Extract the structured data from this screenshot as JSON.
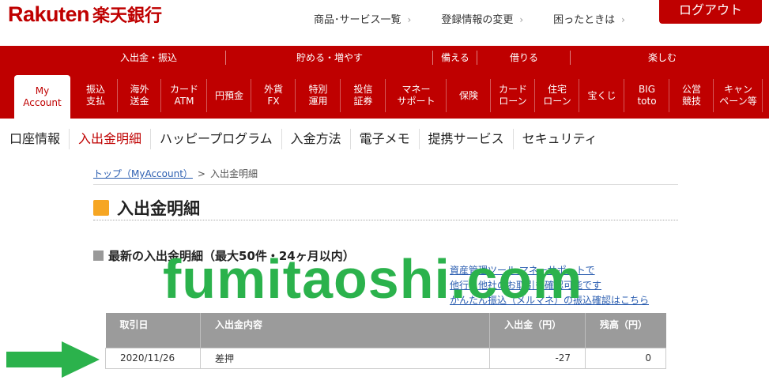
{
  "header": {
    "logo_en": "Rakuten",
    "logo_ja": "楽天銀行",
    "top_links": [
      "商品･サービス一覧",
      "登録情報の変更",
      "困ったときは"
    ],
    "logout_label": "ログアウト"
  },
  "categories": [
    "入出金・振込",
    "貯める・増やす",
    "備える",
    "借りる",
    "楽しむ"
  ],
  "nav": [
    {
      "line1": "My",
      "line2": "Account"
    },
    {
      "line1": "振込",
      "line2": "支払"
    },
    {
      "line1": "海外",
      "line2": "送金"
    },
    {
      "line1": "カード",
      "line2": "ATM"
    },
    {
      "line1": "円預金",
      "line2": ""
    },
    {
      "line1": "外貨",
      "line2": "FX"
    },
    {
      "line1": "特別",
      "line2": "運用"
    },
    {
      "line1": "投信",
      "line2": "証券"
    },
    {
      "line1": "マネー",
      "line2": "サポート"
    },
    {
      "line1": "保険",
      "line2": ""
    },
    {
      "line1": "カード",
      "line2": "ローン"
    },
    {
      "line1": "住宅",
      "line2": "ローン"
    },
    {
      "line1": "宝くじ",
      "line2": ""
    },
    {
      "line1": "BIG",
      "line2": "toto"
    },
    {
      "line1": "公営",
      "line2": "競技"
    },
    {
      "line1": "キャン",
      "line2": "ペーン等"
    }
  ],
  "subtabs": [
    "口座情報",
    "入出金明細",
    "ハッピープログラム",
    "入金方法",
    "電子メモ",
    "提携サービス",
    "セキュリティ"
  ],
  "breadcrumb": {
    "link": "トップ（MyAccount）",
    "sep": ">",
    "current": "入出金明細"
  },
  "page_title": "入出金明細",
  "section_title": "最新の入出金明細（最大50件・24ヶ月以内）",
  "side_links": [
    "資産管理ツール マネーサポートで",
    "他行・他社のお取引も確認可能です",
    "かんたん振込（メルマネ）の振込確認はこちら"
  ],
  "table": {
    "headers": [
      "取引日",
      "入出金内容",
      "入出金（円）",
      "残高（円）"
    ],
    "rows": [
      {
        "date": "2020/11/26",
        "desc": "差押",
        "amount": "-27",
        "balance": "0"
      }
    ]
  },
  "watermark": "fumitaoshi.com",
  "colors": {
    "brand": "#bf0000",
    "accent": "#f6a623",
    "link": "#2a5db0",
    "watermark": "#2bb24c"
  }
}
